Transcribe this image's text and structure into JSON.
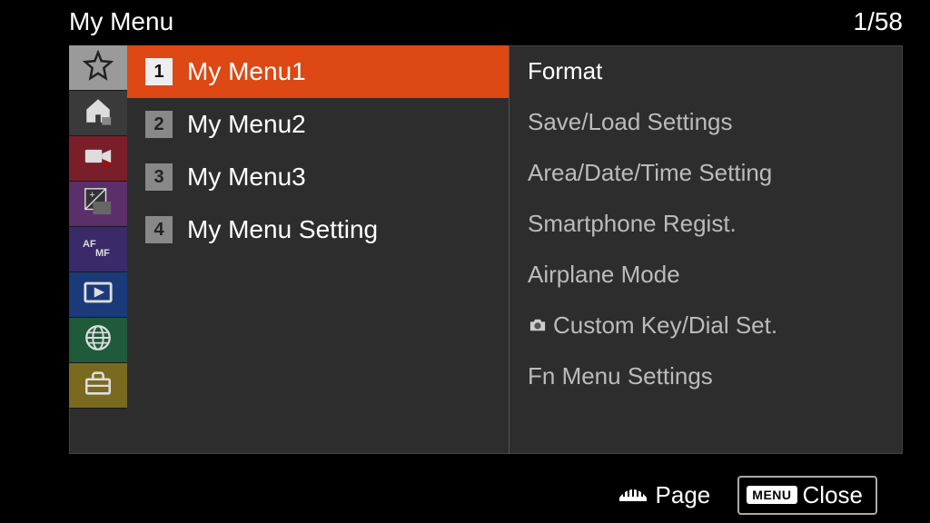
{
  "header": {
    "title": "My Menu",
    "page": "1/58"
  },
  "sidebar": {
    "tabs": [
      {
        "name": "star",
        "bg": "#9a9a9a",
        "selected": true
      },
      {
        "name": "home",
        "bg": "#3a3a3a"
      },
      {
        "name": "video",
        "bg": "#7a1f2a"
      },
      {
        "name": "exposure",
        "bg": "#5a2f6a"
      },
      {
        "name": "afmf",
        "bg": "#3a2a6a"
      },
      {
        "name": "playback",
        "bg": "#1a3a7a"
      },
      {
        "name": "globe",
        "bg": "#1f5a3a"
      },
      {
        "name": "toolbox",
        "bg": "#7a6a1f"
      }
    ]
  },
  "middle": {
    "items": [
      {
        "num": "1",
        "label": "My Menu1",
        "selected": true
      },
      {
        "num": "2",
        "label": "My Menu2"
      },
      {
        "num": "3",
        "label": "My Menu3"
      },
      {
        "num": "4",
        "label": "My Menu Setting"
      }
    ]
  },
  "right": {
    "items": [
      {
        "label": "Format",
        "first": true
      },
      {
        "label": "Save/Load Settings"
      },
      {
        "label": "Area/Date/Time Setting"
      },
      {
        "label": "Smartphone Regist."
      },
      {
        "label": "Airplane Mode"
      },
      {
        "label": "Custom Key/Dial Set.",
        "icon": "camera"
      },
      {
        "label": "Fn Menu Settings"
      }
    ]
  },
  "footer": {
    "page_hint": "Page",
    "menu_badge": "MENU",
    "close": "Close"
  }
}
